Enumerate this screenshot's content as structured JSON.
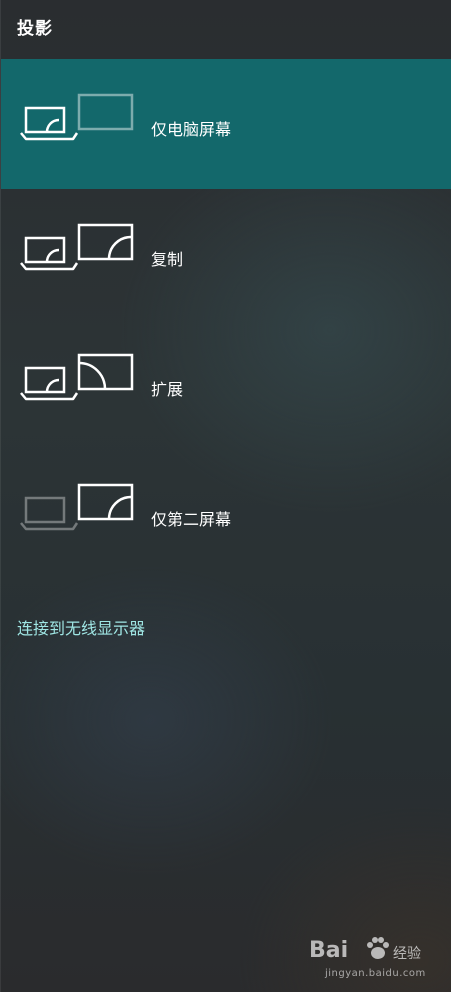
{
  "panel": {
    "title": "投影"
  },
  "options": [
    {
      "label": "仅电脑屏幕",
      "icon": "pc-screen-only-icon",
      "selected": true
    },
    {
      "label": "复制",
      "icon": "duplicate-icon",
      "selected": false
    },
    {
      "label": "扩展",
      "icon": "extend-icon",
      "selected": false
    },
    {
      "label": "仅第二屏幕",
      "icon": "second-screen-only-icon",
      "selected": false
    }
  ],
  "wireless_link": "连接到无线显示器",
  "watermark": {
    "logo_text": "Bai",
    "logo_suffix": "经验",
    "url": "jingyan.baidu.com"
  },
  "colors": {
    "selected_bg": "#13686b",
    "link": "#9fe6e4"
  }
}
